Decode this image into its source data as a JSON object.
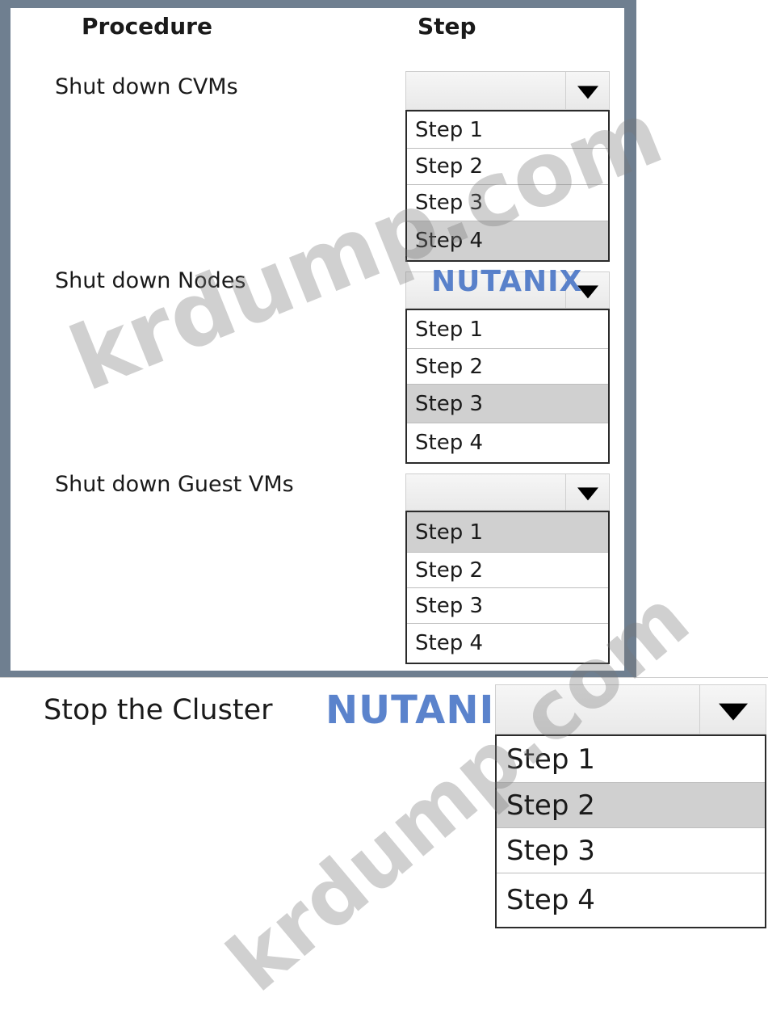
{
  "headers": {
    "procedure": "Procedure",
    "step": "Step"
  },
  "procedures": [
    {
      "label": "Shut  down CVMs",
      "selected_value": "",
      "options": [
        "Step 1",
        "Step 2",
        "Step 3",
        "Step 4"
      ],
      "highlighted_index": 3
    },
    {
      "label": "Shut down Nodes",
      "selected_value": "",
      "options": [
        "Step 1",
        "Step 2",
        "Step 3",
        "Step 4"
      ],
      "highlighted_index": 2
    },
    {
      "label": "Shut down Guest VMs",
      "selected_value": "",
      "options": [
        "Step 1",
        "Step 2",
        "Step 3",
        "Step 4"
      ],
      "highlighted_index": 0
    },
    {
      "label": "Stop the Cluster",
      "selected_value": "",
      "options": [
        "Step 1",
        "Step 2",
        "Step 3",
        "Step 4"
      ],
      "highlighted_index": 1
    }
  ],
  "overlays": {
    "logo_text": "NUTANIX",
    "watermark_text": "krdump.com"
  },
  "colors": {
    "frame": "#6f7f90",
    "highlight": "#d0d0d0",
    "logo": "#3f6ec4"
  }
}
